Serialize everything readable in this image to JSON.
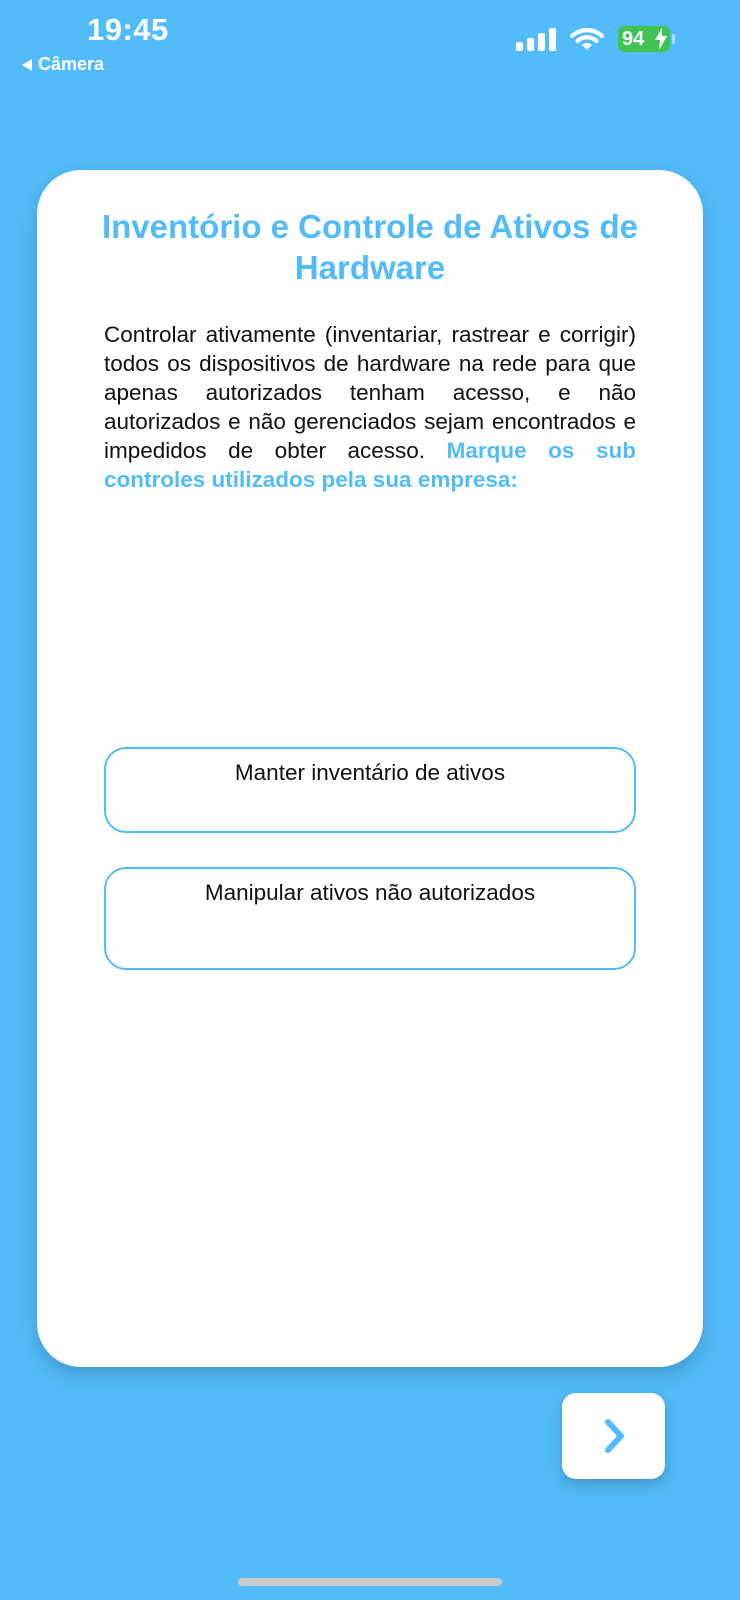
{
  "status_bar": {
    "time": "19:45",
    "back_app": "Câmera",
    "battery_level": "94"
  },
  "card": {
    "title": "Inventório e Controle de Ativos de Hardware",
    "description": "Controlar ativamente (inventariar, rastrear e corrigir) todos os dispositivos de hardware na rede para que apenas autorizados tenham acesso, e não autorizados e não gerenciados sejam encontrados e impedidos de obter acesso.",
    "instruction": "Marque os sub controles utilizados pela sua empresa:",
    "options": [
      {
        "label": "Manter inventário de ativos"
      },
      {
        "label": "Manipular ativos não autorizados"
      }
    ]
  },
  "navigation": {
    "next_icon": "chevron-right-icon"
  },
  "colors": {
    "background": "#52bbf9",
    "accent": "#52bbf9",
    "card": "#ffffff",
    "battery": "#3fc353"
  }
}
